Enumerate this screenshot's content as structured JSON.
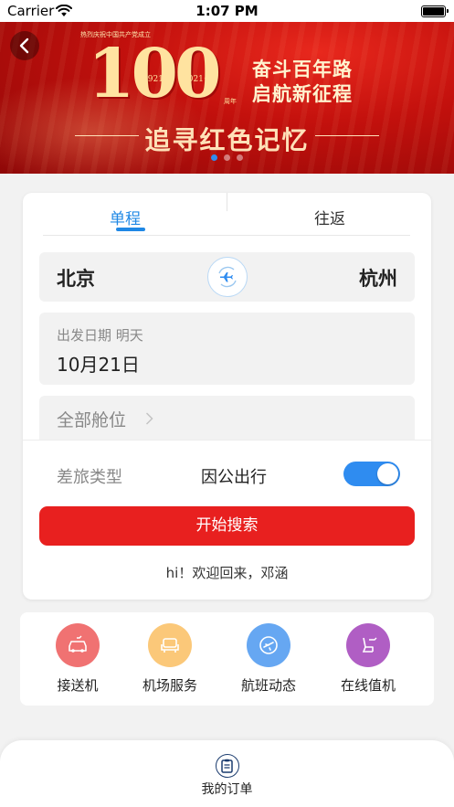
{
  "status_bar": {
    "carrier": "Carrier",
    "time": "1:07 PM",
    "icons": [
      "wifi-icon",
      "battery-icon"
    ]
  },
  "banner": {
    "caption": "热烈庆祝中国共产党成立",
    "hundred": "100",
    "year_start": "★1921",
    "year_end": "2021★",
    "anniversary": "周年",
    "slogan_line1": "奋斗百年路",
    "slogan_line2": "启航新征程",
    "heading": "追寻红色记忆",
    "page_count": 3,
    "active_page": 1
  },
  "trip_tabs": {
    "single": "单程",
    "round": "往返",
    "selected": "单程"
  },
  "route": {
    "from": "北京",
    "to": "杭州",
    "swap_icon": "plane-swap-icon"
  },
  "date": {
    "label": "出发日期 明天",
    "value": "10月21日"
  },
  "cabin": {
    "label": "全部舱位"
  },
  "travel_type": {
    "label": "差旅类型",
    "value": "因公出行",
    "toggle_on": true
  },
  "search": {
    "button_label": "开始搜索"
  },
  "welcome": "hi！欢迎回来，邓涵",
  "services": [
    {
      "label": "接送机",
      "icon": "car-icon",
      "color": "#f07272"
    },
    {
      "label": "机场服务",
      "icon": "seat-icon",
      "color": "#fbc879"
    },
    {
      "label": "航班动态",
      "icon": "flight-status-icon",
      "color": "#66a7f2"
    },
    {
      "label": "在线值机",
      "icon": "checkin-seat-icon",
      "color": "#b05ec4"
    }
  ],
  "bottom_nav": {
    "orders_label": "我的订单",
    "orders_icon": "clipboard-icon"
  },
  "colors": {
    "accent_blue": "#1f88e5",
    "search_red": "#e8201f",
    "banner_red": "#c4110d"
  }
}
